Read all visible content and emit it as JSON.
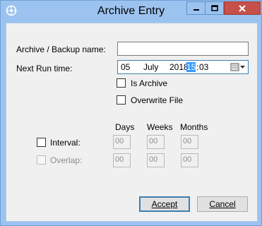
{
  "window": {
    "title": "Archive Entry",
    "icon": "gear-app-icon",
    "controls": {
      "minimize": "minimize-icon",
      "maximize": "maximize-icon",
      "close": "close-icon"
    }
  },
  "form": {
    "name_label": "Archive / Backup name:",
    "name_value": "",
    "run_time_label": "Next Run time:",
    "run_time": {
      "day": "05",
      "month": "July",
      "year": "2018",
      "hour": "15",
      "sep": ":",
      "minute": "03"
    },
    "is_archive_label": "Is Archive",
    "is_archive_checked": false,
    "overwrite_label": "Overwrite File",
    "overwrite_checked": false
  },
  "schedule": {
    "headers": [
      "Days",
      "Weeks",
      "Months"
    ],
    "interval": {
      "label": "Interval:",
      "checked": false,
      "days": "00",
      "weeks": "00",
      "months": "00"
    },
    "overlap": {
      "label": "Overlap:",
      "checked": false,
      "enabled": false,
      "days": "00",
      "weeks": "00",
      "months": "00"
    }
  },
  "buttons": {
    "accept": "Accept",
    "cancel": "Cancel"
  },
  "colors": {
    "frame": "#9cc3ef",
    "close": "#c7504a",
    "selection": "#3399ff"
  }
}
